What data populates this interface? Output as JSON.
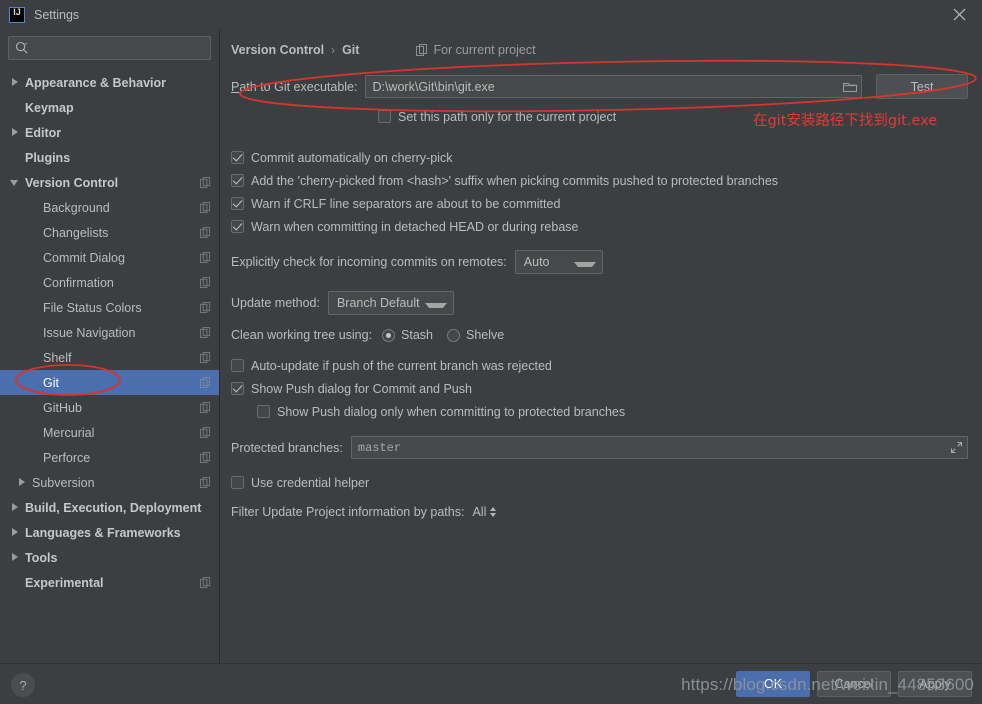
{
  "window": {
    "title": "Settings",
    "app_icon": "intellij-idea-icon",
    "close_icon": "close-icon"
  },
  "sidebar": {
    "search": {
      "placeholder": "",
      "value": "",
      "icon": "search-icon"
    },
    "items": [
      {
        "label": "Appearance & Behavior",
        "level": 0,
        "arrow": "collapsed",
        "bold": true,
        "copy": false,
        "selected": false
      },
      {
        "label": "Keymap",
        "level": 0,
        "arrow": "none",
        "bold": true,
        "copy": false,
        "selected": false
      },
      {
        "label": "Editor",
        "level": 0,
        "arrow": "collapsed",
        "bold": true,
        "copy": false,
        "selected": false
      },
      {
        "label": "Plugins",
        "level": 0,
        "arrow": "none",
        "bold": true,
        "copy": false,
        "selected": false
      },
      {
        "label": "Version Control",
        "level": 0,
        "arrow": "expanded",
        "bold": true,
        "copy": true,
        "selected": false
      },
      {
        "label": "Background",
        "level": 1,
        "arrow": "none",
        "bold": false,
        "copy": true,
        "selected": false
      },
      {
        "label": "Changelists",
        "level": 1,
        "arrow": "none",
        "bold": false,
        "copy": true,
        "selected": false
      },
      {
        "label": "Commit Dialog",
        "level": 1,
        "arrow": "none",
        "bold": false,
        "copy": true,
        "selected": false
      },
      {
        "label": "Confirmation",
        "level": 1,
        "arrow": "none",
        "bold": false,
        "copy": true,
        "selected": false
      },
      {
        "label": "File Status Colors",
        "level": 1,
        "arrow": "none",
        "bold": false,
        "copy": true,
        "selected": false
      },
      {
        "label": "Issue Navigation",
        "level": 1,
        "arrow": "none",
        "bold": false,
        "copy": true,
        "selected": false
      },
      {
        "label": "Shelf",
        "level": 1,
        "arrow": "none",
        "bold": false,
        "copy": true,
        "selected": false
      },
      {
        "label": "Git",
        "level": 1,
        "arrow": "none",
        "bold": false,
        "copy": true,
        "selected": true
      },
      {
        "label": "GitHub",
        "level": 1,
        "arrow": "none",
        "bold": false,
        "copy": true,
        "selected": false
      },
      {
        "label": "Mercurial",
        "level": 1,
        "arrow": "none",
        "bold": false,
        "copy": true,
        "selected": false
      },
      {
        "label": "Perforce",
        "level": 1,
        "arrow": "none",
        "bold": false,
        "copy": true,
        "selected": false
      },
      {
        "label": "Subversion",
        "level": 1,
        "arrow": "collapsed",
        "bold": false,
        "copy": true,
        "selected": false
      },
      {
        "label": "Build, Execution, Deployment",
        "level": 0,
        "arrow": "collapsed",
        "bold": true,
        "copy": false,
        "selected": false
      },
      {
        "label": "Languages & Frameworks",
        "level": 0,
        "arrow": "collapsed",
        "bold": true,
        "copy": false,
        "selected": false
      },
      {
        "label": "Tools",
        "level": 0,
        "arrow": "collapsed",
        "bold": true,
        "copy": false,
        "selected": false
      },
      {
        "label": "Experimental",
        "level": 0,
        "arrow": "none",
        "bold": true,
        "copy": true,
        "selected": false
      }
    ]
  },
  "main": {
    "breadcrumb": {
      "parent": "Version Control",
      "separator": "›",
      "current": "Git"
    },
    "for_current_project": {
      "label": "For current project",
      "icon": "copy-settings-icon"
    },
    "path": {
      "label": "Path to Git executable:",
      "value": "D:\\work\\Git\\bin\\git.exe",
      "browse_icon": "folder-icon",
      "test_button": "Test"
    },
    "set_path_only": {
      "label": "Set this path only for the current project",
      "checked": false
    },
    "checkboxes": [
      {
        "label": "Commit automatically on cherry-pick",
        "checked": true
      },
      {
        "label": "Add the 'cherry-picked from <hash>' suffix when picking commits pushed to protected branches",
        "checked": true
      },
      {
        "label": "Warn if CRLF line separators are about to be committed",
        "checked": true
      },
      {
        "label": "Warn when committing in detached HEAD or during rebase",
        "checked": true
      }
    ],
    "incoming": {
      "label": "Explicitly check for incoming commits on remotes:",
      "value": "Auto"
    },
    "update_method": {
      "label": "Update method:",
      "value": "Branch Default"
    },
    "clean_tree": {
      "label": "Clean working tree using:",
      "options": [
        {
          "label": "Stash",
          "selected": true
        },
        {
          "label": "Shelve",
          "selected": false
        }
      ]
    },
    "push_options": [
      {
        "label": "Auto-update if push of the current branch was rejected",
        "checked": false,
        "indent": false
      },
      {
        "label": "Show Push dialog for Commit and Push",
        "checked": true,
        "indent": false
      },
      {
        "label": "Show Push dialog only when committing to protected branches",
        "checked": false,
        "indent": true
      }
    ],
    "protected_branches": {
      "label": "Protected branches:",
      "value": "master",
      "expand_icon": "expand-icon"
    },
    "credential_helper": {
      "label": "Use credential helper",
      "checked": false
    },
    "filter_paths": {
      "label": "Filter Update Project information by paths:",
      "value": "All"
    }
  },
  "footer": {
    "help_icon": "question-mark-icon",
    "buttons": [
      {
        "label": "OK",
        "primary": true
      },
      {
        "label": "Cancel",
        "primary": false
      },
      {
        "label": "Apply",
        "primary": false
      }
    ],
    "watermark": "https://blog.csdn.net/weixin_44853600"
  },
  "annotations": {
    "note_text": "在git安装路径下找到git.exe",
    "color": "#e03b33"
  }
}
